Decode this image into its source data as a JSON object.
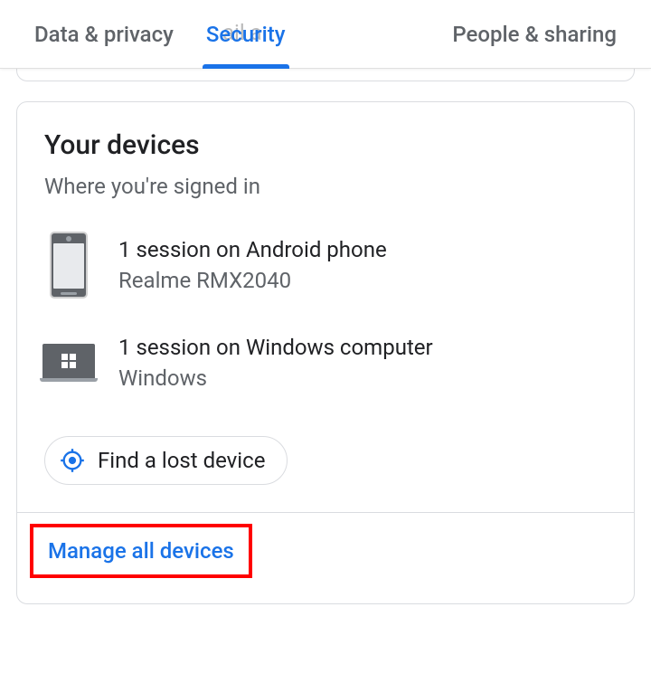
{
  "tabs": {
    "data_privacy": "Data & privacy",
    "security": "Security",
    "people_sharing": "People & sharing"
  },
  "ghost_text": "ail a",
  "card": {
    "title": "Your devices",
    "subtitle": "Where you're signed in",
    "devices": [
      {
        "title": "1 session on Android phone",
        "subtitle": "Realme RMX2040",
        "type": "phone"
      },
      {
        "title": "1 session on Windows computer",
        "subtitle": "Windows",
        "type": "laptop"
      }
    ],
    "find_device": "Find a lost device",
    "manage_all": "Manage all devices"
  }
}
